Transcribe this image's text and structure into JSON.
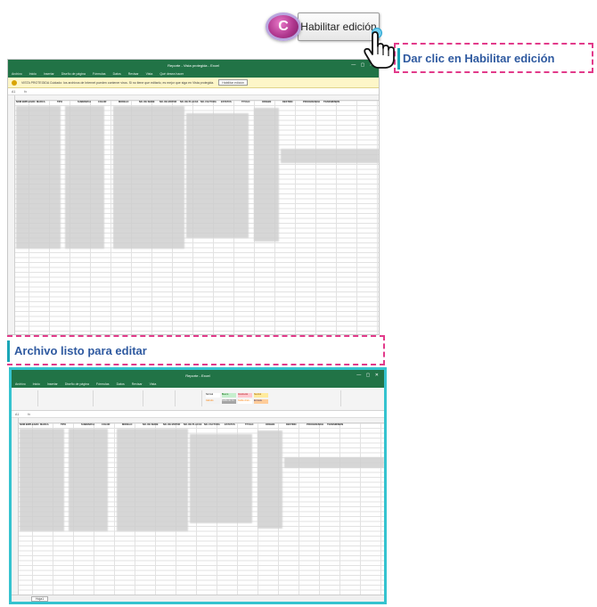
{
  "step": {
    "badge": "C"
  },
  "top_callout": {
    "button_label": "Habilitar edición",
    "instruction": "Dar clic en Habilitar edición"
  },
  "middle_callout": {
    "text": "Archivo listo para editar"
  },
  "excel_protected": {
    "title": "Reporte - Vista protegida - Excel",
    "menu": [
      "Archivo",
      "Inicio",
      "Insertar",
      "Diseño de página",
      "Fórmulas",
      "Datos",
      "Revisar",
      "Vista",
      "Qué desea hacer"
    ],
    "protected_message": "VISTA PROTEGIDA  Cuidado: los archivos de Internet pueden contener virus. Si no tiene que editarlo, es mejor que siga en Vista protegida.",
    "enable_button": "Habilitar edición",
    "formula": "fx",
    "columns": [
      "A",
      "B",
      "C",
      "D",
      "E",
      "F",
      "G",
      "H",
      "I",
      "J",
      "K",
      "L",
      "M",
      "N",
      "O",
      "P",
      "Q",
      "R"
    ],
    "headers": [
      "NOM EMPLEADO",
      "MARCA",
      "TIPO",
      "SUBMARCA",
      "COLOR",
      "MODELO",
      "NO. DE SERIE",
      "NO. DE MOTOR",
      "NO. DE PLACAS",
      "NO. FACTURA",
      "ESTATUS",
      "TITULO",
      "ORIGEN",
      "DESTINO",
      "PROCEDENCIA",
      "TRANSMISION"
    ]
  },
  "excel_editable": {
    "title": "Reporte - Excel",
    "styles": [
      "Normal",
      "Bueno",
      "Incorrecto",
      "Neutral",
      "Cálculo",
      "Celda de co...",
      "Celda vincu...",
      "Entrada",
      "Notas",
      "Salida"
    ],
    "sheet_tab": "Hoja1",
    "headers": [
      "NOM EMPLEADO",
      "MARCA",
      "TIPO",
      "SUBMARCA",
      "COLOR",
      "MODELO",
      "NO. DE SERIE",
      "NO. DE MOTOR",
      "NO. DE PLACAS",
      "NO. FACTURA",
      "ESTATUS",
      "TITULO",
      "ORIGEN",
      "DESTINO",
      "PROCEDENCIA",
      "TRANSMISION"
    ]
  },
  "colors": {
    "excel_green": "#217346",
    "callout_border": "#e23a8a",
    "callout_text": "#2f5aa0",
    "frame_cyan": "#35c3cf",
    "badge": "#b0378f"
  }
}
